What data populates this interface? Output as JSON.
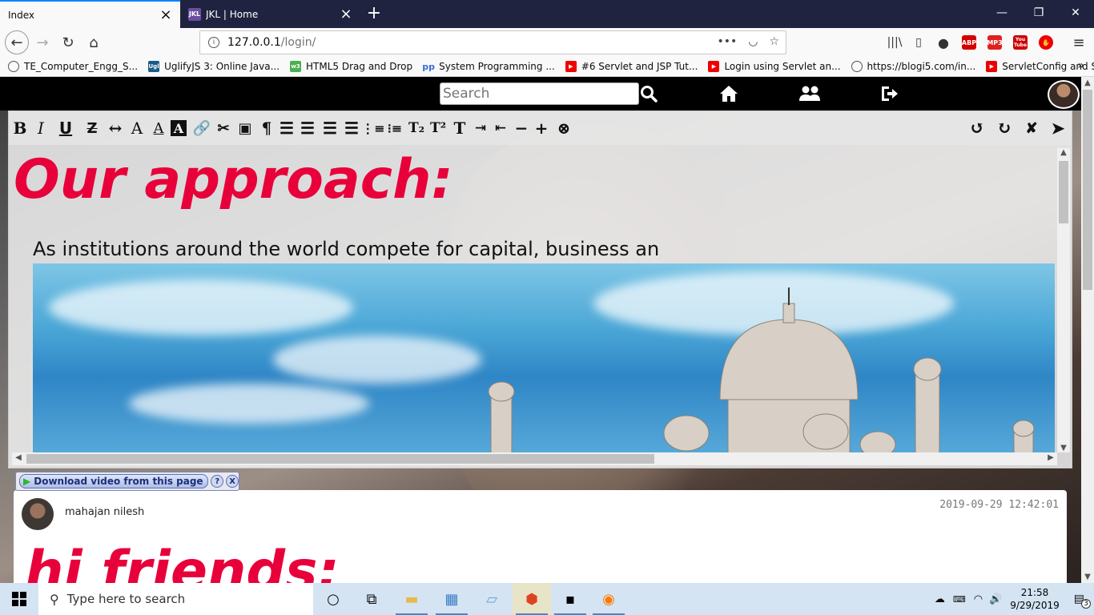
{
  "browser": {
    "tabs": [
      {
        "title": "Index",
        "active": true
      },
      {
        "title": "JKL | Home",
        "active": false,
        "favicon": "JKL"
      }
    ],
    "url_host": "127.0.0.1",
    "url_path": "/login/",
    "bookmarks": [
      "TE_Computer_Engg_S...",
      "UglifyJS 3: Online Java...",
      "HTML5 Drag and Drop",
      "System Programming ...",
      "#6 Servlet and JSP Tut...",
      "Login using Servlet an...",
      "https://blogi5.com/in...",
      "ServletConfig and Serv..."
    ],
    "extensions": [
      "ABP",
      "MP3",
      "You Tube"
    ]
  },
  "topnav": {
    "search_placeholder": "Search",
    "icons": [
      "search-icon",
      "home-icon",
      "users-icon",
      "logout-icon"
    ]
  },
  "editor": {
    "toolbar_left": [
      "B",
      "I",
      "U",
      "Z",
      "↔",
      "A",
      "A",
      "A",
      "🔗",
      "⛓",
      "🖼",
      "¶",
      "≡",
      "≡",
      "≡",
      "≡",
      "1≡",
      "•≡",
      "T₂",
      "T²",
      "T",
      "⇥",
      "⇤",
      "−",
      "+",
      "⊗"
    ],
    "toolbar_right": [
      "undo",
      "redo",
      "discard",
      "send"
    ],
    "heading": "Our approach:",
    "paragraph": "As institutions around the world compete for capital, business an"
  },
  "post": {
    "author": "mahajan nilesh",
    "date": "2019-09-29 12:42:01",
    "heading": "hi friends:"
  },
  "download_bar": {
    "label": "Download video from this page",
    "help": "?",
    "close": "X"
  },
  "taskbar": {
    "search_placeholder": "Type here to search",
    "time": "21:58",
    "date": "9/29/2019",
    "notifications": "3"
  }
}
